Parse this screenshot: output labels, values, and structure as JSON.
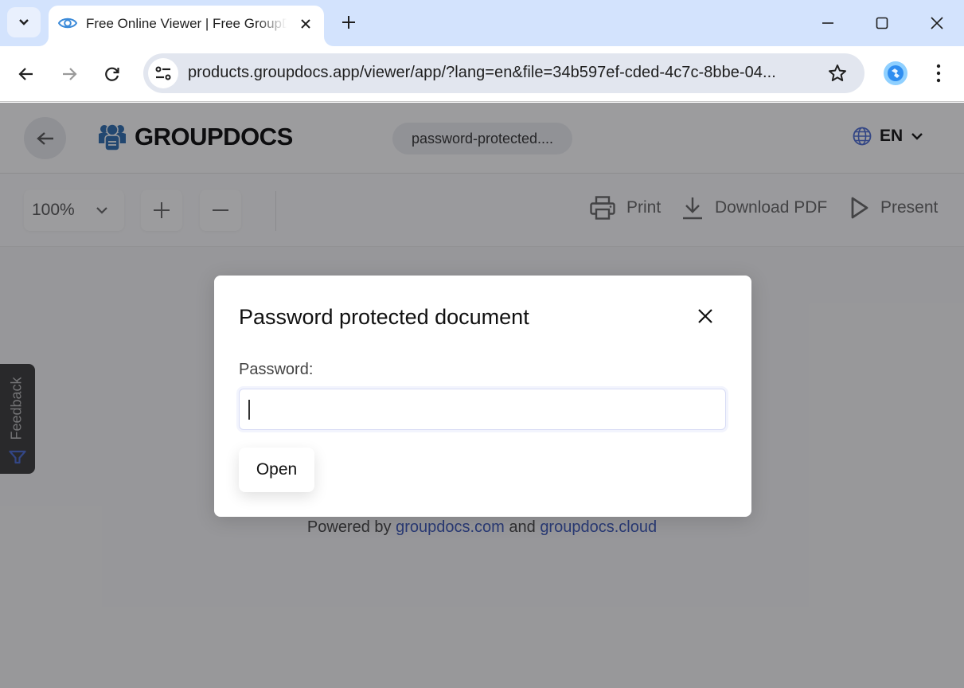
{
  "browser": {
    "tab": {
      "title": "Free Online Viewer | Free GroupDocs App",
      "favicon": "eye-icon"
    },
    "url": "products.groupdocs.app/viewer/app/?lang=en&file=34b597ef-cded-4c7c-8bbe-04...",
    "icons": {
      "tab_search": "chevron-down-icon",
      "tab_close": "close-icon",
      "new_tab": "plus-icon",
      "minimize": "minimize-icon",
      "maximize": "maximize-icon",
      "close_window": "close-icon",
      "back": "arrow-left-icon",
      "forward": "arrow-right-icon",
      "reload": "reload-icon",
      "site_info": "tune-icon",
      "bookmark": "star-icon",
      "extension": "extension-icon",
      "menu": "kebab-menu-icon"
    }
  },
  "app": {
    "logo_text": "GROUPDOCS",
    "file_name": "password-protected....",
    "language": "EN",
    "toolbar": {
      "zoom": "100%",
      "print": "Print",
      "download": "Download PDF",
      "present": "Present"
    },
    "footer": {
      "prefix": "Powered by ",
      "link1": "groupdocs.com",
      "middle": " and ",
      "link2": "groupdocs.cloud"
    },
    "feedback": "Feedback",
    "colors": {
      "brand_blue": "#2e6db0",
      "link": "#3a56b8",
      "globe": "#4a6cd4"
    }
  },
  "modal": {
    "title": "Password protected document",
    "password_label": "Password:",
    "password_value": "",
    "open_button": "Open"
  }
}
